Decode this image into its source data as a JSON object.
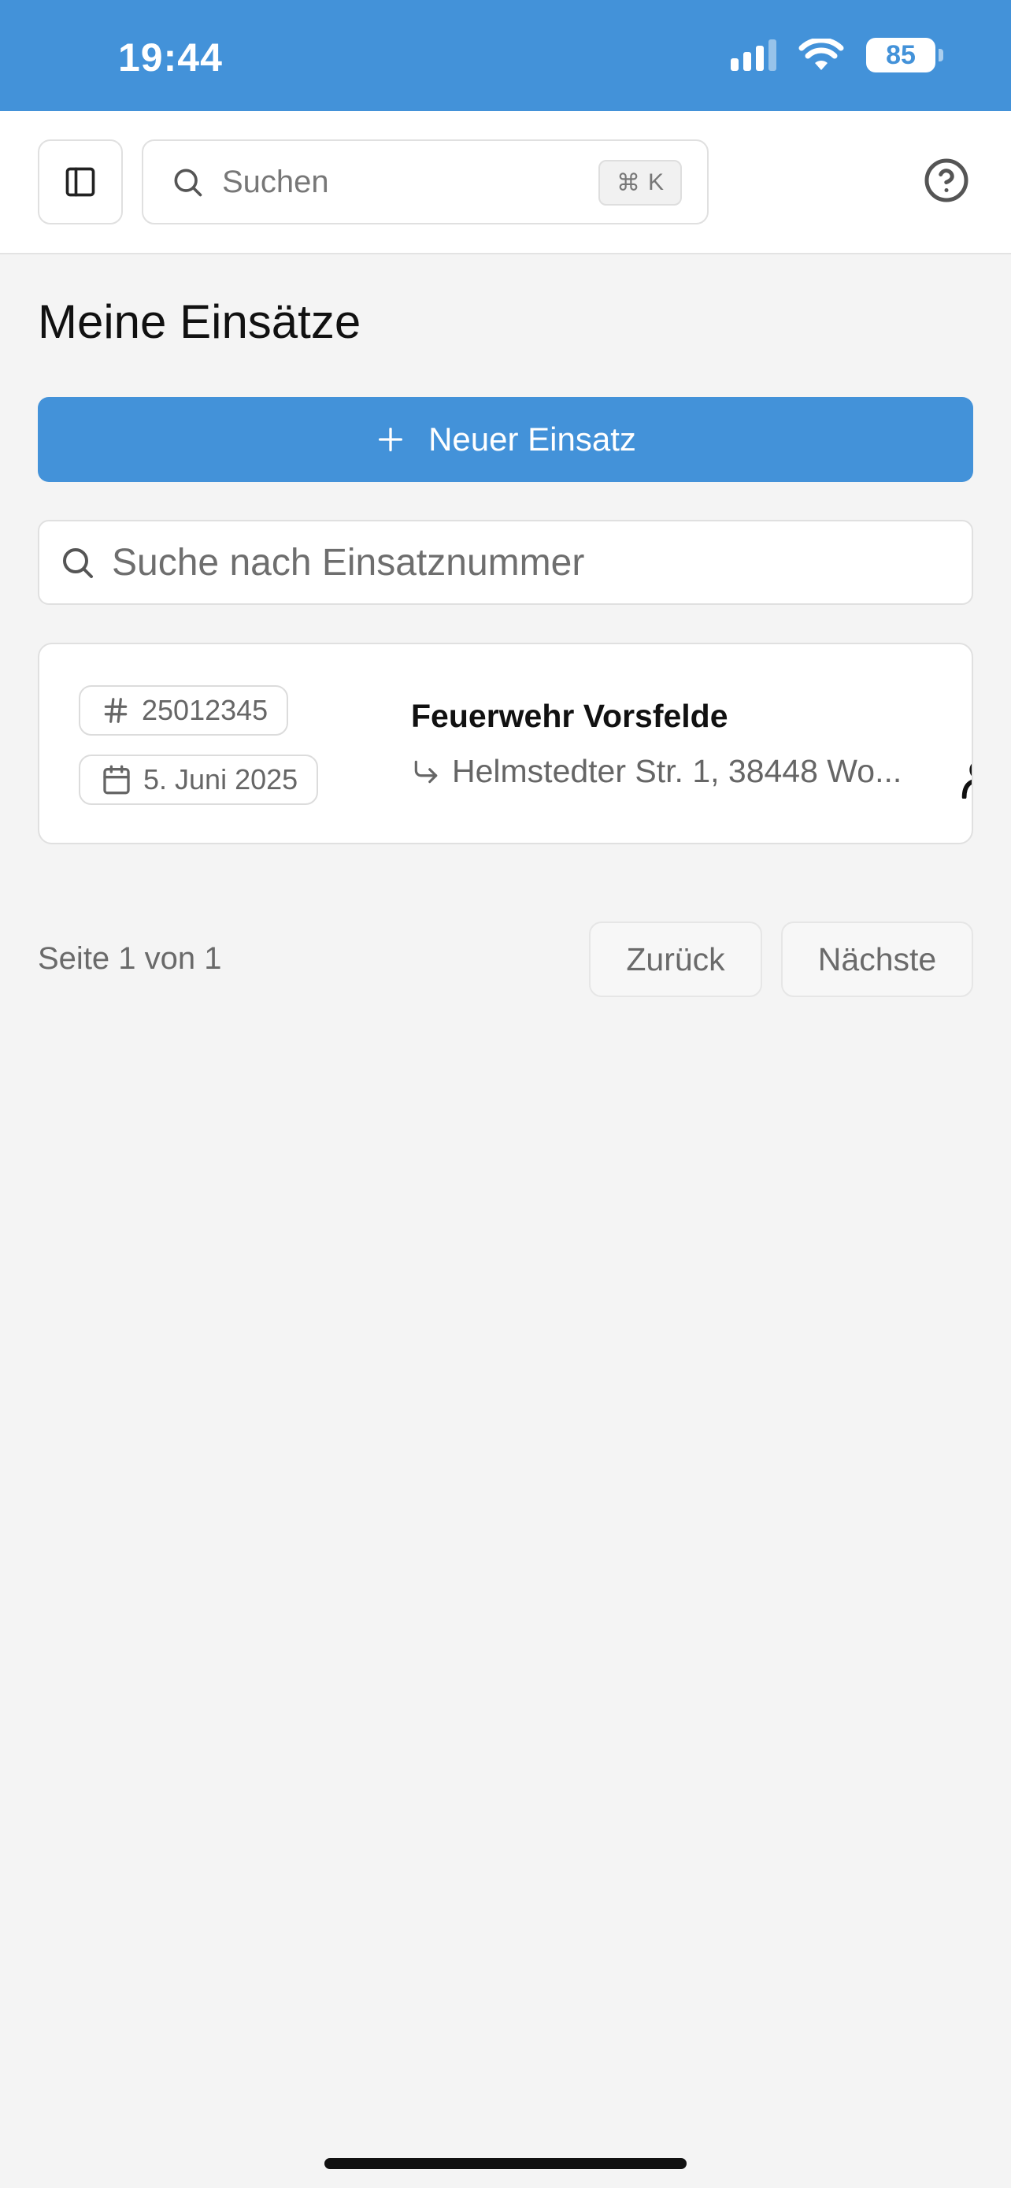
{
  "status_bar": {
    "time": "19:44",
    "battery": "85",
    "colors": {
      "background": "#4392d9"
    }
  },
  "topbar": {
    "search_placeholder": "Suchen",
    "shortcut_symbol": "⌘",
    "shortcut_key": "K"
  },
  "page": {
    "title": "Meine Einsätze",
    "new_button_label": "Neuer Einsatz",
    "filter_placeholder": "Suche nach Einsatznummer"
  },
  "missions": [
    {
      "number": "25012345",
      "date": "5. Juni 2025",
      "organization": "Feuerwehr Vorsfelde",
      "address": "Helmstedter Str. 1, 38448 Wo..."
    }
  ],
  "pagination": {
    "info": "Seite 1 von 1",
    "back_label": "Zurück",
    "next_label": "Nächste"
  },
  "colors": {
    "accent": "#4392d9",
    "page_background": "#f4f4f4",
    "card_background": "#ffffff"
  },
  "icons": {
    "sidebar_toggle": "sidebar-icon",
    "search": "search-icon",
    "help": "help-circle-icon",
    "add": "plus-icon",
    "mission_number": "hash-icon",
    "mission_date": "calendar-icon",
    "address": "corner-down-right-icon"
  }
}
